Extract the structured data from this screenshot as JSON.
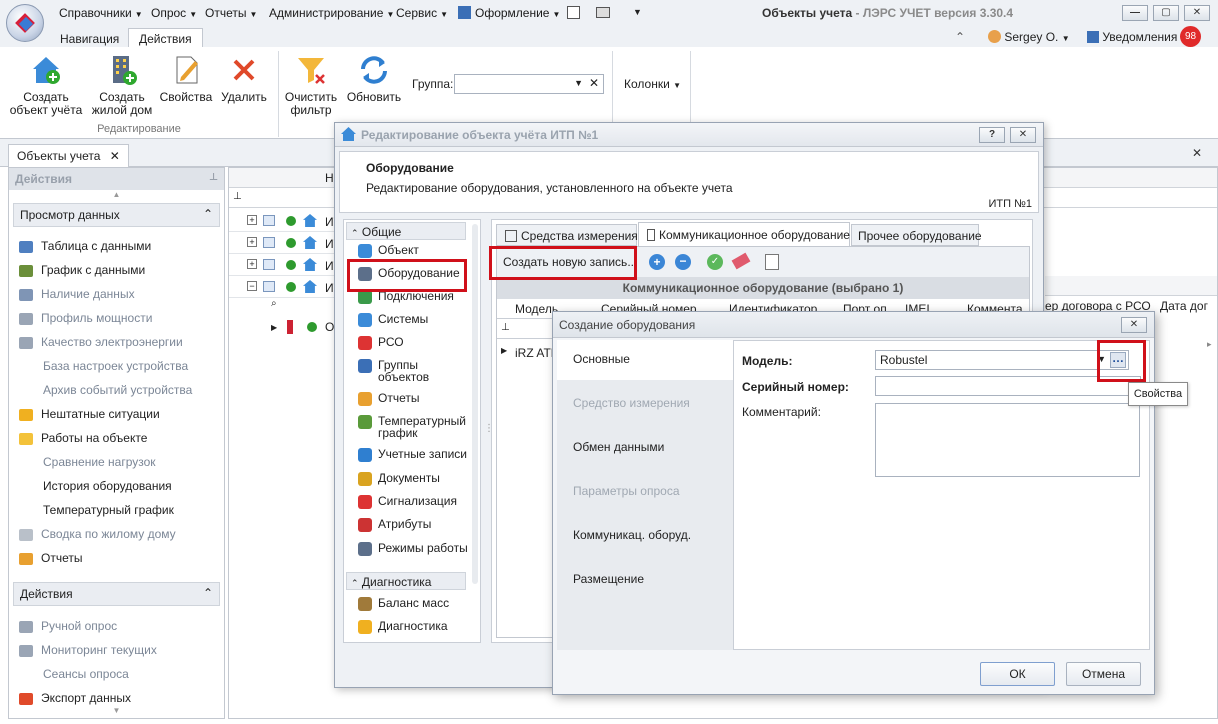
{
  "app": {
    "title_main": "Объекты учета",
    "title_sub": " - ЛЭРС УЧЕТ версия 3.30.4"
  },
  "menu": {
    "items": [
      "Справочники",
      "Опрос",
      "Отчеты",
      "Администрирование",
      "Сервис",
      "Оформление"
    ]
  },
  "ribbon_tabs": [
    "Навигация",
    "Действия"
  ],
  "ribbon": {
    "create_object": "Создать\nобъект учёта",
    "create_house": "Создать\nжилой дом",
    "properties": "Свойства",
    "delete": "Удалить",
    "group_label": "Редактирование",
    "clear_filter": "Очистить\nфильтр",
    "refresh": "Обновить",
    "group_field_label": "Группа:",
    "columns": "Колонки"
  },
  "user": {
    "name": "Sergey O.",
    "notifications_label": "Уведомления",
    "notifications_count": "98"
  },
  "doc_tab": "Объекты учета",
  "left_panel": {
    "header": "Действия",
    "group1": "Просмотр данных",
    "items1": [
      {
        "label": "Таблица с данными",
        "icon": "table-icon",
        "gray": false
      },
      {
        "label": "График с данными",
        "icon": "chart-icon",
        "gray": false
      },
      {
        "label": "Наличие данных",
        "icon": "availability-icon",
        "gray": true
      },
      {
        "label": "Профиль мощности",
        "icon": "power-icon",
        "gray": true
      },
      {
        "label": "Качество электроэнергии",
        "icon": "quality-icon",
        "gray": true
      },
      {
        "label": "База настроек устройства",
        "icon": "",
        "gray": true
      },
      {
        "label": "Архив событий устройства",
        "icon": "",
        "gray": true
      },
      {
        "label": "Нештатные ситуации",
        "icon": "warning-icon",
        "gray": false
      },
      {
        "label": "Работы на объекте",
        "icon": "helmet-icon",
        "gray": false
      },
      {
        "label": "Сравнение нагрузок",
        "icon": "",
        "gray": true
      },
      {
        "label": "История оборудования",
        "icon": "",
        "gray": false
      },
      {
        "label": "Температурный график",
        "icon": "",
        "gray": false
      },
      {
        "label": "Сводка по жилому дому",
        "icon": "house-summary-icon",
        "gray": true
      },
      {
        "label": "Отчеты",
        "icon": "report-icon",
        "gray": false
      }
    ],
    "group2": "Действия",
    "items2": [
      {
        "label": "Ручной опрос",
        "icon": "play-icon",
        "gray": true
      },
      {
        "label": "Мониторинг текущих",
        "icon": "monitor-icon",
        "gray": true
      },
      {
        "label": "Сеансы опроса",
        "icon": "",
        "gray": true
      },
      {
        "label": "Экспорт данных",
        "icon": "export-icon",
        "gray": false
      }
    ]
  },
  "grid": {
    "col_name_short": "На",
    "row_prefix": "ИТ",
    "sub_row_prefix": "О",
    "right_col1": "ер договора с РСО",
    "right_col2": "Дата дог"
  },
  "edit_window": {
    "title": "Редактирование объекта учёта ИТП №1",
    "section_title": "Оборудование",
    "section_desc": "Редактирование оборудования, установленного на объекте учета",
    "object_name": "ИТП №1",
    "nav_group1": "Общие",
    "nav_items": [
      {
        "label": "Объект",
        "icon": "house-icon"
      },
      {
        "label": "Оборудование",
        "icon": "gauge-icon"
      },
      {
        "label": "Подключения",
        "icon": "connection-icon"
      },
      {
        "label": "Системы",
        "icon": "systems-icon"
      },
      {
        "label": "РСО",
        "icon": "rso-icon"
      },
      {
        "label": "Группы\nобъектов",
        "icon": "groups-icon"
      },
      {
        "label": "Отчеты",
        "icon": "report-icon"
      },
      {
        "label": "Температурный\nграфик",
        "icon": "temp-chart-icon"
      },
      {
        "label": "Учетные записи",
        "icon": "accounts-icon"
      },
      {
        "label": "Документы",
        "icon": "documents-icon"
      },
      {
        "label": "Сигнализация",
        "icon": "alarm-icon"
      },
      {
        "label": "Атрибуты",
        "icon": "attributes-icon"
      },
      {
        "label": "Режимы работы",
        "icon": "calendar-icon"
      }
    ],
    "nav_group2": "Диагностика",
    "nav_items2": [
      {
        "label": "Баланс масс",
        "icon": "balance-icon"
      },
      {
        "label": "Диагностика",
        "icon": "warning-icon"
      }
    ],
    "tabs": [
      "Средства измерения",
      "Коммуникационное оборудование",
      "Прочее оборудование"
    ],
    "create_record": "Создать новую запись...",
    "table_caption": "Коммуникационное оборудование (выбрано 1)",
    "columns": [
      "Модель",
      "Серийный номер",
      "Идентификатор",
      "Порт оп",
      "IMEI",
      "Коммента"
    ],
    "row_model": "iRZ ATM"
  },
  "create_dialog": {
    "title": "Создание оборудования",
    "nav": [
      {
        "label": "Основные",
        "active": true,
        "gray": false
      },
      {
        "label": "Средство измерения",
        "active": false,
        "gray": true
      },
      {
        "label": "Обмен данными",
        "active": false,
        "gray": false
      },
      {
        "label": "Параметры опроса",
        "active": false,
        "gray": true
      },
      {
        "label": "Коммуникац. оборуд.",
        "active": false,
        "gray": false
      },
      {
        "label": "Размещение",
        "active": false,
        "gray": false
      }
    ],
    "model_label": "Модель:",
    "model_value": "Robustel",
    "serial_label": "Серийный номер:",
    "serial_value": "",
    "comment_label": "Комментарий:",
    "comment_value": "",
    "tooltip": "Свойства",
    "ok": "ОК",
    "cancel": "Отмена"
  }
}
